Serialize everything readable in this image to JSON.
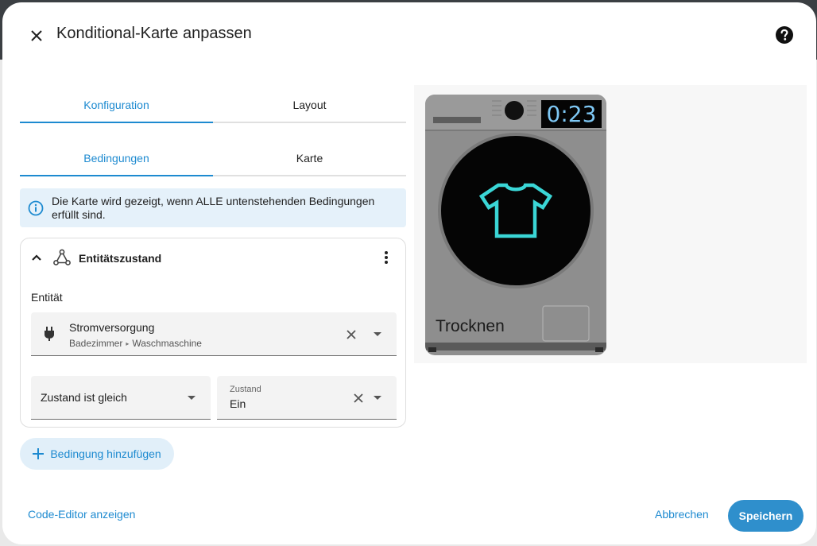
{
  "dialog": {
    "title": "Konditional-Karte anpassen"
  },
  "tabs_main": [
    {
      "label": "Konfiguration",
      "active": true
    },
    {
      "label": "Layout",
      "active": false
    }
  ],
  "tabs_sub": [
    {
      "label": "Bedingungen",
      "active": true
    },
    {
      "label": "Karte",
      "active": false
    }
  ],
  "info": {
    "text": "Die Karte wird gezeigt, wenn ALLE untenstehenden Bedingungen erfüllt sind."
  },
  "condition": {
    "title": "Entitätszustand",
    "entity_label": "Entität",
    "entity": {
      "name": "Stromversorgung",
      "area": "Badezimmer",
      "device": "Waschmaschine"
    },
    "operator": "Zustand ist gleich",
    "state_label": "Zustand",
    "state_value": "Ein"
  },
  "add_condition_label": "Bedingung hinzufügen",
  "preview": {
    "timer": "0:23",
    "status": "Trocknen"
  },
  "footer": {
    "code_editor": "Code-Editor anzeigen",
    "cancel": "Abbrechen",
    "save": "Speichern"
  },
  "colors": {
    "accent": "#1d8ad0",
    "save_bg": "#2f8fcc",
    "info_bg": "#e5f1fa",
    "icon_cyan": "#3ad6d6"
  },
  "icons": [
    "close-icon",
    "help-icon",
    "info-icon",
    "chevron-up-icon",
    "condition-icon",
    "more-vert-icon",
    "plug-icon",
    "clear-icon",
    "dropdown-icon",
    "plus-icon",
    "tshirt-icon"
  ]
}
